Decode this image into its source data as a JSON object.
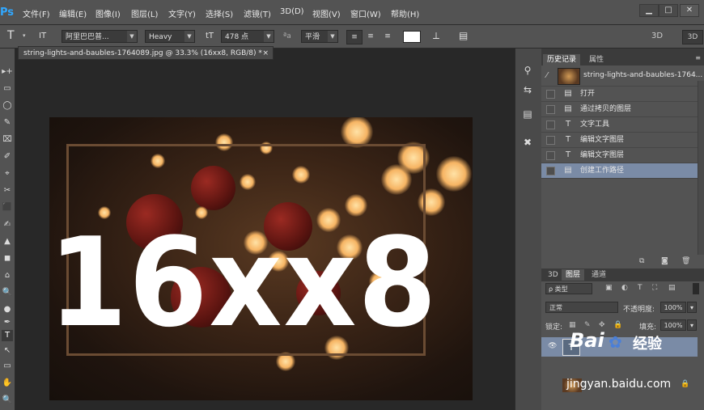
{
  "app": {
    "logo": "Ps"
  },
  "menu": [
    "文件(F)",
    "编辑(E)",
    "图像(I)",
    "图层(L)",
    "文字(Y)",
    "选择(S)",
    "滤镜(T)",
    "3D(D)",
    "视图(V)",
    "窗口(W)",
    "帮助(H)"
  ],
  "window_controls": {
    "minimize": "▁",
    "restore": "□",
    "close": "✕"
  },
  "options_bar": {
    "tool_icon": "T",
    "orientation_icon": "IT",
    "font_family": "阿里巴巴普...",
    "font_style": "Heavy",
    "size_icon": "tT",
    "font_size": "478 点",
    "aa_icon": "ªa",
    "antialias": "平滑",
    "color_swatch": "#ffffff",
    "three_d_label": "3D",
    "three_d_button": "3D"
  },
  "document": {
    "tab_title": "string-lights-and-baubles-1764089.jpg @ 33.3% (16xx8, RGB/8) *",
    "close_icon": "×",
    "canvas_text": "16xx8"
  },
  "tools": [
    "▸+",
    "▭",
    "◯",
    "✎",
    "⌧",
    "✐",
    "⌖",
    "✂",
    "⬛",
    "✍",
    "▲",
    "◼",
    "⌂",
    "🔍",
    "●",
    "✒",
    "T",
    "↖",
    "▭",
    "✋",
    "🔍"
  ],
  "side_strip": [
    "⚲",
    "⇆",
    "▤",
    "✖"
  ],
  "history_panel": {
    "tabs": [
      "历史记录",
      "属性"
    ],
    "snapshot_label": "string-lights-and-baubles-1764...",
    "items": [
      {
        "icon": "doc-icon",
        "glyph": "▤",
        "label": "打开"
      },
      {
        "icon": "doc-icon",
        "glyph": "▤",
        "label": "通过拷贝的图层"
      },
      {
        "icon": "type-icon",
        "glyph": "T",
        "label": "文字工具"
      },
      {
        "icon": "type-icon",
        "glyph": "T",
        "label": "编辑文字图层"
      },
      {
        "icon": "type-icon",
        "glyph": "T",
        "label": "编辑文字图层"
      },
      {
        "icon": "doc-icon",
        "glyph": "▤",
        "label": "创建工作路径"
      }
    ],
    "selected_index": 5
  },
  "layers_panel": {
    "tabs": [
      "3D",
      "图层",
      "通道"
    ],
    "filter_label": "ρ 类型",
    "blend_mode": "正常",
    "opacity_label": "不透明度:",
    "opacity_value": "100%",
    "lock_label": "锁定:",
    "fill_label": "填充:",
    "fill_value": "100%",
    "type_layer_glyph": "T"
  },
  "watermark": {
    "brand": "Bai",
    "suffix": "经验",
    "url": "jingyan.baidu.com"
  }
}
